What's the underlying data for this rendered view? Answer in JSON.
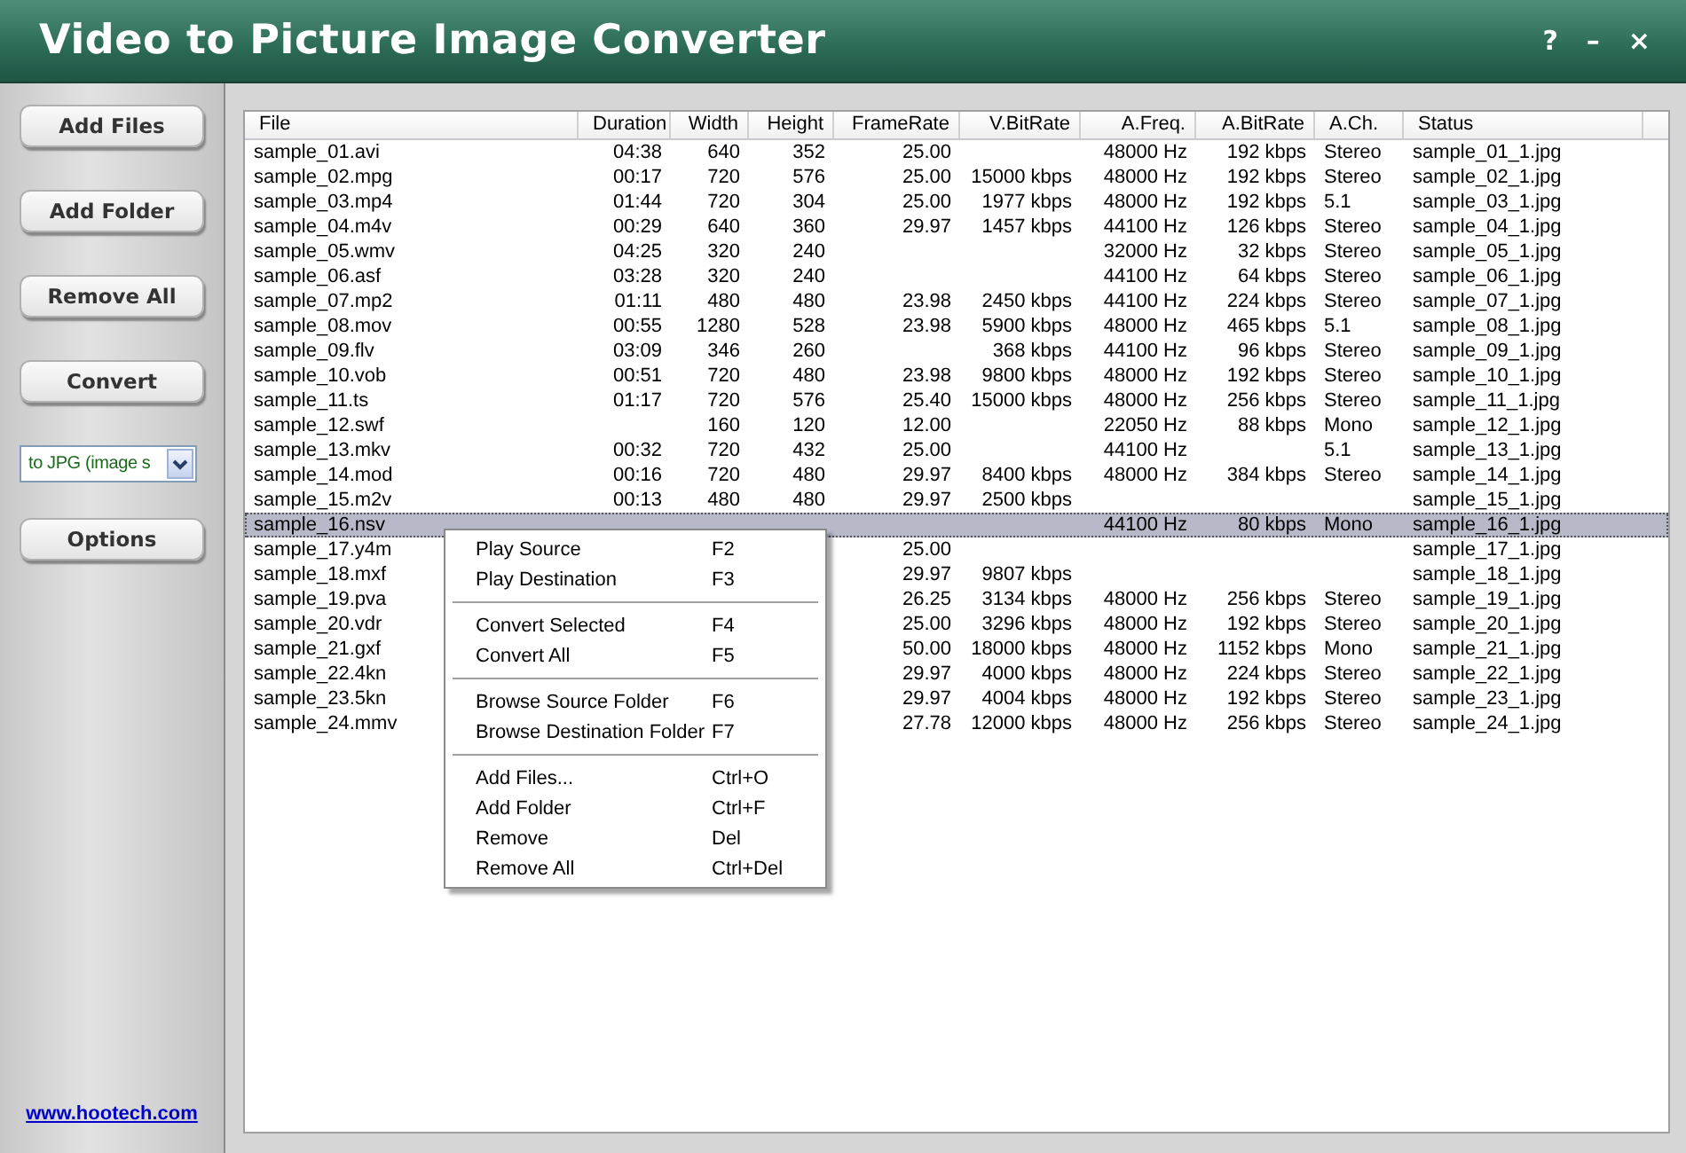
{
  "window": {
    "title": "Video to Picture Image Converter",
    "controls": [
      "?",
      "–",
      "×"
    ]
  },
  "sidebar": {
    "buttons": [
      "Add Files",
      "Add Folder",
      "Remove All",
      "Convert"
    ],
    "format_select": {
      "value": "to JPG (image s"
    },
    "options_button": "Options",
    "link": "www.hootech.com"
  },
  "table": {
    "columns": [
      "File",
      "Duration",
      "Width",
      "Height",
      "FrameRate",
      "V.BitRate",
      "A.Freq.",
      "A.BitRate",
      "A.Ch.",
      "Status"
    ],
    "rows": [
      {
        "selected": false,
        "cells": [
          "sample_01.avi",
          "04:38",
          "640",
          "352",
          "25.00",
          null,
          "48000 Hz",
          "192 kbps",
          "Stereo",
          "sample_01_1.jpg"
        ]
      },
      {
        "selected": false,
        "cells": [
          "sample_02.mpg",
          "00:17",
          "720",
          "576",
          "25.00",
          "15000 kbps",
          "48000 Hz",
          "192 kbps",
          "Stereo",
          "sample_02_1.jpg"
        ]
      },
      {
        "selected": false,
        "cells": [
          "sample_03.mp4",
          "01:44",
          "720",
          "304",
          "25.00",
          "1977 kbps",
          "48000 Hz",
          "192 kbps",
          "5.1",
          "sample_03_1.jpg"
        ]
      },
      {
        "selected": false,
        "cells": [
          "sample_04.m4v",
          "00:29",
          "640",
          "360",
          "29.97",
          "1457 kbps",
          "44100 Hz",
          "126 kbps",
          "Stereo",
          "sample_04_1.jpg"
        ]
      },
      {
        "selected": false,
        "cells": [
          "sample_05.wmv",
          "04:25",
          "320",
          "240",
          null,
          null,
          "32000 Hz",
          "32 kbps",
          "Stereo",
          "sample_05_1.jpg"
        ]
      },
      {
        "selected": false,
        "cells": [
          "sample_06.asf",
          "03:28",
          "320",
          "240",
          null,
          null,
          "44100 Hz",
          "64 kbps",
          "Stereo",
          "sample_06_1.jpg"
        ]
      },
      {
        "selected": false,
        "cells": [
          "sample_07.mp2",
          "01:11",
          "480",
          "480",
          "23.98",
          "2450 kbps",
          "44100 Hz",
          "224 kbps",
          "Stereo",
          "sample_07_1.jpg"
        ]
      },
      {
        "selected": false,
        "cells": [
          "sample_08.mov",
          "00:55",
          "1280",
          "528",
          "23.98",
          "5900 kbps",
          "48000 Hz",
          "465 kbps",
          "5.1",
          "sample_08_1.jpg"
        ]
      },
      {
        "selected": false,
        "cells": [
          "sample_09.flv",
          "03:09",
          "346",
          "260",
          null,
          "368 kbps",
          "44100 Hz",
          "96 kbps",
          "Stereo",
          "sample_09_1.jpg"
        ]
      },
      {
        "selected": false,
        "cells": [
          "sample_10.vob",
          "00:51",
          "720",
          "480",
          "23.98",
          "9800 kbps",
          "48000 Hz",
          "192 kbps",
          "Stereo",
          "sample_10_1.jpg"
        ]
      },
      {
        "selected": false,
        "cells": [
          "sample_11.ts",
          "01:17",
          "720",
          "576",
          "25.40",
          "15000 kbps",
          "48000 Hz",
          "256 kbps",
          "Stereo",
          "sample_11_1.jpg"
        ]
      },
      {
        "selected": false,
        "cells": [
          "sample_12.swf",
          null,
          "160",
          "120",
          "12.00",
          null,
          "22050 Hz",
          "88 kbps",
          "Mono",
          "sample_12_1.jpg"
        ]
      },
      {
        "selected": false,
        "cells": [
          "sample_13.mkv",
          "00:32",
          "720",
          "432",
          "25.00",
          null,
          "44100 Hz",
          null,
          "5.1",
          "sample_13_1.jpg"
        ]
      },
      {
        "selected": false,
        "cells": [
          "sample_14.mod",
          "00:16",
          "720",
          "480",
          "29.97",
          "8400 kbps",
          "48000 Hz",
          "384 kbps",
          "Stereo",
          "sample_14_1.jpg"
        ]
      },
      {
        "selected": false,
        "cells": [
          "sample_15.m2v",
          "00:13",
          "480",
          "480",
          "29.97",
          "2500 kbps",
          null,
          null,
          null,
          "sample_15_1.jpg"
        ]
      },
      {
        "selected": true,
        "cells": [
          "sample_16.nsv",
          null,
          null,
          null,
          null,
          null,
          "44100 Hz",
          "80 kbps",
          "Mono",
          "sample_16_1.jpg"
        ]
      },
      {
        "selected": false,
        "cells": [
          "sample_17.y4m",
          null,
          null,
          null,
          "25.00",
          null,
          null,
          null,
          null,
          "sample_17_1.jpg"
        ]
      },
      {
        "selected": false,
        "cells": [
          "sample_18.mxf",
          null,
          null,
          null,
          "29.97",
          "9807 kbps",
          null,
          null,
          null,
          "sample_18_1.jpg"
        ]
      },
      {
        "selected": false,
        "cells": [
          "sample_19.pva",
          null,
          null,
          null,
          "26.25",
          "3134 kbps",
          "48000 Hz",
          "256 kbps",
          "Stereo",
          "sample_19_1.jpg"
        ]
      },
      {
        "selected": false,
        "cells": [
          "sample_20.vdr",
          null,
          null,
          null,
          "25.00",
          "3296 kbps",
          "48000 Hz",
          "192 kbps",
          "Stereo",
          "sample_20_1.jpg"
        ]
      },
      {
        "selected": false,
        "cells": [
          "sample_21.gxf",
          null,
          null,
          null,
          "50.00",
          "18000 kbps",
          "48000 Hz",
          "1152 kbps",
          "Mono",
          "sample_21_1.jpg"
        ]
      },
      {
        "selected": false,
        "cells": [
          "sample_22.4kn",
          null,
          null,
          null,
          "29.97",
          "4000 kbps",
          "48000 Hz",
          "224 kbps",
          "Stereo",
          "sample_22_1.jpg"
        ]
      },
      {
        "selected": false,
        "cells": [
          "sample_23.5kn",
          null,
          null,
          null,
          "29.97",
          "4004 kbps",
          "48000 Hz",
          "192 kbps",
          "Stereo",
          "sample_23_1.jpg"
        ]
      },
      {
        "selected": false,
        "cells": [
          "sample_24.mmv",
          null,
          null,
          null,
          "27.78",
          "12000 kbps",
          "48000 Hz",
          "256 kbps",
          "Stereo",
          "sample_24_1.jpg"
        ]
      }
    ]
  },
  "context_menu": {
    "groups": [
      [
        {
          "label": "Play Source",
          "shortcut": "F2"
        },
        {
          "label": "Play Destination",
          "shortcut": "F3"
        }
      ],
      [
        {
          "label": "Convert Selected",
          "shortcut": "F4"
        },
        {
          "label": "Convert All",
          "shortcut": "F5"
        }
      ],
      [
        {
          "label": "Browse Source Folder",
          "shortcut": "F6"
        },
        {
          "label": "Browse Destination Folder",
          "shortcut": "F7"
        }
      ],
      [
        {
          "label": "Add Files...",
          "shortcut": "Ctrl+O"
        },
        {
          "label": "Add Folder",
          "shortcut": "Ctrl+F"
        },
        {
          "label": "Remove",
          "shortcut": "Del"
        },
        {
          "label": "Remove All",
          "shortcut": "Ctrl+Del"
        }
      ]
    ]
  }
}
